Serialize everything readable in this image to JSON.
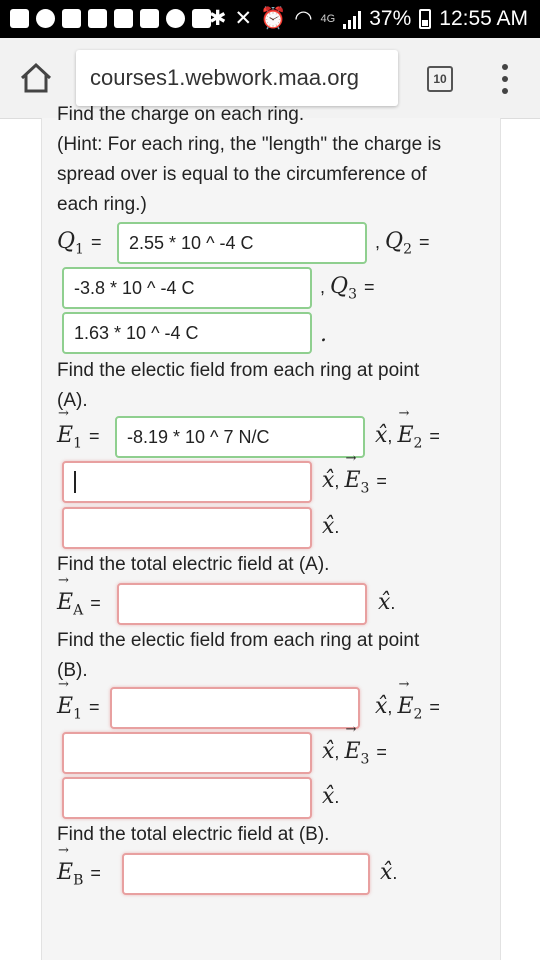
{
  "status": {
    "battery": "37%",
    "time": "12:55 AM",
    "network": "4G"
  },
  "browser": {
    "url": "courses1.webwork.maa.org",
    "tab_count": "10"
  },
  "problem": {
    "cut_heading": "Find the charge on each ring.",
    "hint_lines": [
      "(Hint: For each ring, the \"length\" the charge is",
      "spread over is equal to the circumference of",
      "each ring.)"
    ],
    "q1_value": "2.55 * 10 ^ -4 C",
    "q2_value": "-3.8 * 10 ^ -4 C",
    "q3_value": "1.63 * 10 ^ -4 C",
    "fieldA_lines": [
      "Find the electic field from each ring at point",
      "(A)."
    ],
    "eA1_value": "-8.19 * 10 ^ 7 N/C",
    "totalA_label": "Find the total electric field at (A).",
    "fieldB_lines": [
      "Find the electic field from each ring at point",
      "(B)."
    ],
    "totalB_label": "Find the total electric field at (B)."
  },
  "labels": {
    "eq": "=",
    "comma_eq": ", ",
    "xhat": "x̂",
    "period": "."
  }
}
